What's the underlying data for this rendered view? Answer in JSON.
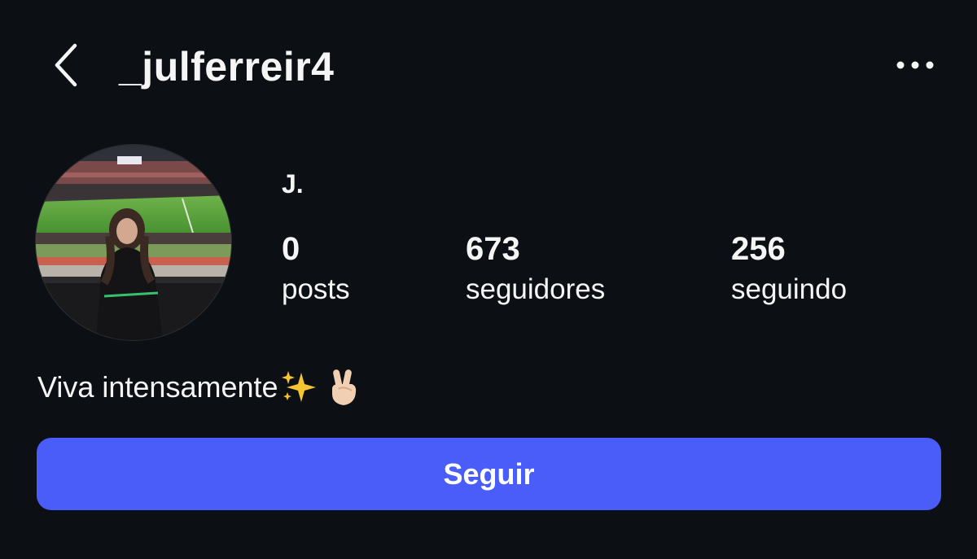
{
  "header": {
    "username": "_julferreir4",
    "back_icon": "chevron-left-icon",
    "more_icon": "more-horizontal-icon"
  },
  "profile": {
    "display_name": "J.",
    "avatar_icon": "profile-photo-avatar",
    "stats": {
      "posts_count": "0",
      "posts_label": "posts",
      "followers_count": "673",
      "followers_label": "seguidores",
      "following_count": "256",
      "following_label": "seguindo"
    },
    "bio": {
      "text": "Viva intensamente",
      "emoji_1": "sparkles-emoji",
      "emoji_2": "victory-hand-emoji"
    }
  },
  "actions": {
    "follow_label": "Seguir"
  },
  "colors": {
    "background": "#0c1014",
    "text": "#f5f5f5",
    "follow_button": "#4a5df9"
  }
}
